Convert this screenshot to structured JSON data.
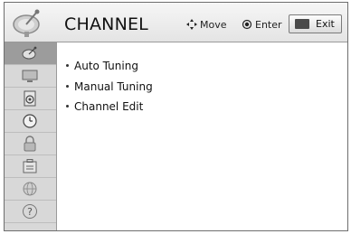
{
  "header": {
    "title": "CHANNEL",
    "move_hint": "Move",
    "enter_hint": "Enter",
    "exit_label": "Exit",
    "logo_icon": "satellite-dish-icon"
  },
  "sidebar": {
    "items": [
      {
        "icon": "satellite-dish-icon",
        "active": true
      },
      {
        "icon": "monitor-icon",
        "active": false
      },
      {
        "icon": "speaker-icon",
        "active": false
      },
      {
        "icon": "clock-icon",
        "active": false
      },
      {
        "icon": "lock-icon",
        "active": false
      },
      {
        "icon": "options-icon",
        "active": false
      },
      {
        "icon": "network-icon",
        "active": false
      },
      {
        "icon": "help-icon",
        "active": false
      }
    ]
  },
  "menu": {
    "items": [
      {
        "label": "Auto Tuning"
      },
      {
        "label": "Manual Tuning"
      },
      {
        "label": "Channel Edit"
      }
    ]
  }
}
